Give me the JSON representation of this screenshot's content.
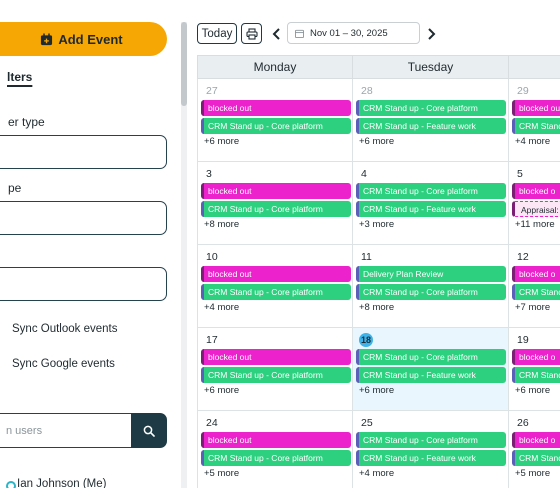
{
  "sidebar": {
    "add_event_label": "Add Event",
    "filters_title": "lters",
    "owner_type_label": "er type",
    "type_label": "pe",
    "sync_outlook_label": "Sync Outlook events",
    "sync_google_label": "Sync Google events",
    "user_search_placeholder": "n users",
    "user_name": "Ian Johnson (Me)"
  },
  "toolbar": {
    "today_label": "Today",
    "date_range": "Nov 01 – 30, 2025"
  },
  "calendar": {
    "day_headers": [
      "Monday",
      "Tuesday",
      "W"
    ],
    "weeks": [
      {
        "days": [
          {
            "num": "27",
            "muted": true,
            "today": false,
            "events": [
              {
                "label": "blocked out",
                "kind": "pink"
              },
              {
                "label": "CRM Stand up - Core platform",
                "kind": "green"
              }
            ],
            "more": "+6 more"
          },
          {
            "num": "28",
            "muted": true,
            "today": false,
            "events": [
              {
                "label": "CRM Stand up - Core platform",
                "kind": "green"
              },
              {
                "label": "CRM Stand up - Feature work",
                "kind": "green"
              }
            ],
            "more": "+6 more"
          },
          {
            "num": "29",
            "muted": true,
            "today": false,
            "events": [
              {
                "label": "blocked out",
                "kind": "pink"
              },
              {
                "label": "CRM Stand",
                "kind": "green"
              }
            ],
            "more": "+4 more"
          }
        ]
      },
      {
        "days": [
          {
            "num": "3",
            "muted": false,
            "today": false,
            "events": [
              {
                "label": "blocked out",
                "kind": "pink"
              },
              {
                "label": "CRM Stand up - Core platform",
                "kind": "green"
              }
            ],
            "more": "+8 more"
          },
          {
            "num": "4",
            "muted": false,
            "today": false,
            "events": [
              {
                "label": "CRM Stand up - Core platform",
                "kind": "green"
              },
              {
                "label": "CRM Stand up - Feature work",
                "kind": "green"
              }
            ],
            "more": "+3 more"
          },
          {
            "num": "5",
            "muted": false,
            "today": false,
            "events": [
              {
                "label": "blocked o",
                "kind": "pink"
              },
              {
                "label": "Appraisal:",
                "kind": "dashed"
              }
            ],
            "more": "+11 more"
          }
        ]
      },
      {
        "days": [
          {
            "num": "10",
            "muted": false,
            "today": false,
            "events": [
              {
                "label": "blocked out",
                "kind": "pink"
              },
              {
                "label": "CRM Stand up - Core platform",
                "kind": "green"
              }
            ],
            "more": "+4 more"
          },
          {
            "num": "11",
            "muted": false,
            "today": false,
            "events": [
              {
                "label": "Delivery Plan Review",
                "kind": "green"
              },
              {
                "label": "CRM Stand up - Core platform",
                "kind": "green"
              }
            ],
            "more": "+8 more"
          },
          {
            "num": "12",
            "muted": false,
            "today": false,
            "events": [
              {
                "label": "blocked o",
                "kind": "pink"
              },
              {
                "label": "CRM Stand",
                "kind": "green"
              }
            ],
            "more": "+7 more"
          }
        ]
      },
      {
        "days": [
          {
            "num": "17",
            "muted": false,
            "today": false,
            "events": [
              {
                "label": "blocked out",
                "kind": "pink"
              },
              {
                "label": "CRM Stand up - Core platform",
                "kind": "green"
              }
            ],
            "more": "+6 more"
          },
          {
            "num": "18",
            "muted": false,
            "today": true,
            "events": [
              {
                "label": "CRM Stand up - Core platform",
                "kind": "green"
              },
              {
                "label": "CRM Stand up - Feature work",
                "kind": "green"
              }
            ],
            "more": "+6 more"
          },
          {
            "num": "19",
            "muted": false,
            "today": false,
            "events": [
              {
                "label": "blocked o",
                "kind": "pink"
              },
              {
                "label": "CRM Stand",
                "kind": "green"
              }
            ],
            "more": "+6 more"
          }
        ]
      },
      {
        "days": [
          {
            "num": "24",
            "muted": false,
            "today": false,
            "events": [
              {
                "label": "blocked out",
                "kind": "pink"
              },
              {
                "label": "CRM Stand up - Core platform",
                "kind": "green"
              }
            ],
            "more": "+5 more"
          },
          {
            "num": "25",
            "muted": false,
            "today": false,
            "events": [
              {
                "label": "CRM Stand up - Core platform",
                "kind": "green"
              },
              {
                "label": "CRM Stand up - Feature work",
                "kind": "green"
              }
            ],
            "more": "+4 more"
          },
          {
            "num": "26",
            "muted": false,
            "today": false,
            "events": [
              {
                "label": "blocked o",
                "kind": "pink"
              },
              {
                "label": "CRM Stand",
                "kind": "green"
              }
            ],
            "more": "+5 more"
          }
        ]
      }
    ]
  },
  "colors": {
    "accent_orange": "#f6a704",
    "event_pink": "#ec22cc",
    "event_green": "#2dd07f",
    "today_bg": "#e9f6fd",
    "dark_teal": "#1d3a45"
  },
  "icons": {
    "add_event": "calendar-plus-icon",
    "print": "printer-icon",
    "prev": "chevron-left-icon",
    "next": "chevron-right-icon",
    "date": "calendar-icon",
    "search": "search-icon"
  }
}
